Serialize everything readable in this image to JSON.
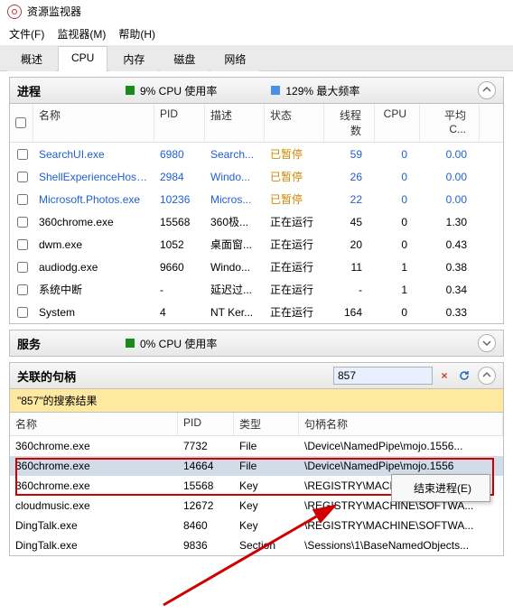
{
  "title": "资源监视器",
  "menubar": [
    "文件(F)",
    "监视器(M)",
    "帮助(H)"
  ],
  "tabs": [
    "概述",
    "CPU",
    "内存",
    "磁盘",
    "网络"
  ],
  "active_tab": "CPU",
  "process_section": {
    "title": "进程",
    "stat1": "9% CPU 使用率",
    "stat2": "129% 最大频率"
  },
  "process_columns": {
    "name": "名称",
    "pid": "PID",
    "desc": "描述",
    "status": "状态",
    "threads": "线程数",
    "cpu": "CPU",
    "avg": "平均 C..."
  },
  "processes": [
    {
      "name": "SearchUI.exe",
      "pid": "6980",
      "desc": "Search...",
      "status": "已暂停",
      "threads": "59",
      "cpu": "0",
      "avg": "0.00",
      "link": true,
      "suspended": true
    },
    {
      "name": "ShellExperienceHost.exe",
      "pid": "2984",
      "desc": "Windo...",
      "status": "已暂停",
      "threads": "26",
      "cpu": "0",
      "avg": "0.00",
      "link": true,
      "suspended": true
    },
    {
      "name": "Microsoft.Photos.exe",
      "pid": "10236",
      "desc": "Micros...",
      "status": "已暂停",
      "threads": "22",
      "cpu": "0",
      "avg": "0.00",
      "link": true,
      "suspended": true
    },
    {
      "name": "360chrome.exe",
      "pid": "15568",
      "desc": "360极...",
      "status": "正在运行",
      "threads": "45",
      "cpu": "0",
      "avg": "1.30"
    },
    {
      "name": "dwm.exe",
      "pid": "1052",
      "desc": "桌面窗...",
      "status": "正在运行",
      "threads": "20",
      "cpu": "0",
      "avg": "0.43"
    },
    {
      "name": "audiodg.exe",
      "pid": "9660",
      "desc": "Windo...",
      "status": "正在运行",
      "threads": "11",
      "cpu": "1",
      "avg": "0.38"
    },
    {
      "name": "系统中断",
      "pid": "-",
      "desc": "延迟过...",
      "status": "正在运行",
      "threads": "-",
      "cpu": "1",
      "avg": "0.34"
    },
    {
      "name": "System",
      "pid": "4",
      "desc": "NT Ker...",
      "status": "正在运行",
      "threads": "164",
      "cpu": "0",
      "avg": "0.33"
    }
  ],
  "services_section": {
    "title": "服务",
    "stat1": "0% CPU 使用率"
  },
  "handles_section": {
    "title": "关联的句柄",
    "search_value": "857",
    "result_banner": "\"857\"的搜索结果"
  },
  "handle_columns": {
    "name": "名称",
    "pid": "PID",
    "type": "类型",
    "path": "句柄名称"
  },
  "handles": [
    {
      "name": "360chrome.exe",
      "pid": "7732",
      "type": "File",
      "path": "\\Device\\NamedPipe\\mojo.1556..."
    },
    {
      "name": "360chrome.exe",
      "pid": "14664",
      "type": "File",
      "path": "\\Device\\NamedPipe\\mojo.1556",
      "hl": true
    },
    {
      "name": "360chrome.exe",
      "pid": "15568",
      "type": "Key",
      "path": "\\REGISTRY\\MACHINE\\SOFTWA"
    },
    {
      "name": "cloudmusic.exe",
      "pid": "12672",
      "type": "Key",
      "path": "\\REGISTRY\\MACHINE\\SOFTWA..."
    },
    {
      "name": "DingTalk.exe",
      "pid": "8460",
      "type": "Key",
      "path": "\\REGISTRY\\MACHINE\\SOFTWA..."
    },
    {
      "name": "DingTalk.exe",
      "pid": "9836",
      "type": "Section",
      "path": "\\Sessions\\1\\BaseNamedObjects..."
    }
  ],
  "context_menu": {
    "item": "结束进程(E)"
  }
}
